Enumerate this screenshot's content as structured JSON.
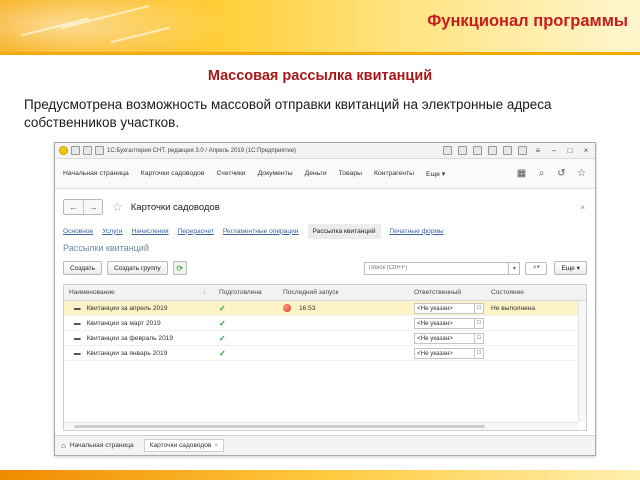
{
  "slide": {
    "title": "Функционал программы",
    "subtitle": "Массовая рассылка квитанций",
    "body": "Предусмотрена возможность массовой отправки квитанций на электронные адреса собственников участков."
  },
  "app": {
    "window_title": "1С:Бухгалтерия СНТ, редакция 3.0 / Апрель 2019 (1С:Предприятие)",
    "nav": {
      "items": [
        "Начальная страница",
        "Карточки садоводов",
        "Счетчики",
        "Документы",
        "Деньги",
        "Товары",
        "Контрагенты"
      ],
      "more": "Еще ▾"
    },
    "form": {
      "title": "Карточки садоводов",
      "tabs": [
        "Основное",
        "Услуги",
        "Начисления",
        "Перерасчет",
        "Регламентные операции",
        "Рассылка квитанций",
        "Печатные формы"
      ],
      "active_tab": "Рассылка квитанций",
      "section_title": "Рассылки квитанций",
      "buttons": {
        "create": "Создать",
        "create_group": "Создать группу",
        "more": "Еще ▾"
      },
      "search_placeholder": "Поиск (Ctrl+F)"
    },
    "table": {
      "headers": [
        "Наименование",
        "Подготовлена",
        "Последний запуск",
        "Ответственный",
        "Состояние"
      ],
      "sort_indicator": "↓",
      "rows": [
        {
          "name": "Квитанции за апрель 2019",
          "prepared": "✓",
          "last_run": "16:53",
          "responsible": "<Не указан>",
          "state": "Не выполнена",
          "selected": true,
          "has_status": true
        },
        {
          "name": "Квитанции за март 2019",
          "prepared": "✓",
          "last_run": "",
          "responsible": "<Не указан>",
          "state": "",
          "selected": false,
          "has_status": false
        },
        {
          "name": "Квитанции за февраль 2019",
          "prepared": "✓",
          "last_run": "",
          "responsible": "<Не указан>",
          "state": "",
          "selected": false,
          "has_status": false
        },
        {
          "name": "Квитанции за январь 2019",
          "prepared": "✓",
          "last_run": "",
          "responsible": "<Не указан>",
          "state": "",
          "selected": false,
          "has_status": false
        }
      ]
    },
    "footer": {
      "tabs": [
        "Начальная страница",
        "Карточки садоводов"
      ],
      "close": "×"
    },
    "colors": {
      "accent_title": "#c51d1d",
      "selected_row": "#fdf3c6",
      "link": "#3b62a3"
    }
  }
}
